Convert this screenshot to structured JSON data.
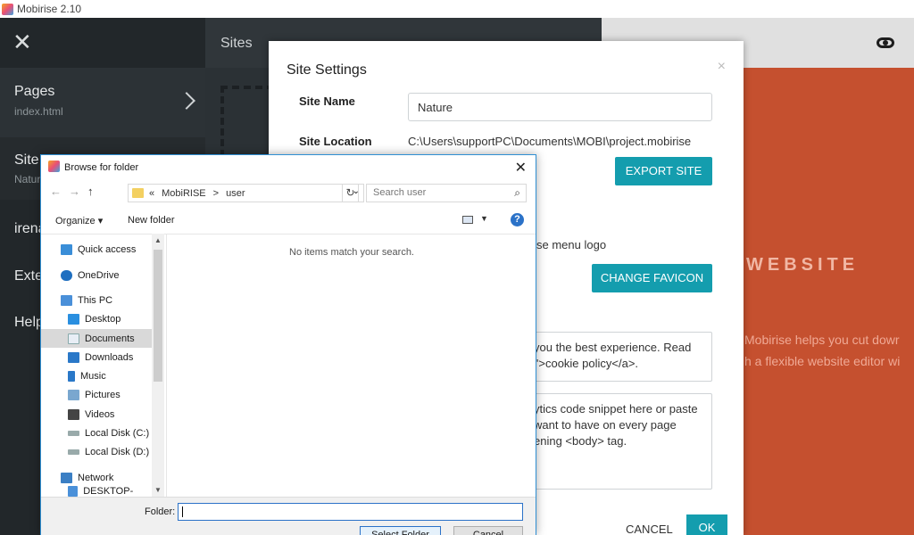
{
  "window": {
    "title": "Mobirise 2.10"
  },
  "sidebar": {
    "items": [
      {
        "label": "Pages",
        "sub": "index.html"
      },
      {
        "label": "Site",
        "sub": "Natur"
      },
      {
        "label": "irena"
      },
      {
        "label": "Exte"
      },
      {
        "label": "Help"
      }
    ]
  },
  "sites_panel": {
    "title": "Sites"
  },
  "preview": {
    "heading": "WEBSITE",
    "para_line1": "Mobirise helps you cut dowr",
    "para_line2": "h a flexible website editor wi"
  },
  "settings": {
    "title": "Site Settings",
    "close": "×",
    "site_name_label": "Site Name",
    "site_name_value": "Nature",
    "site_location_label": "Site Location",
    "site_location_value": "C:\\Users\\supportPC\\Documents\\MOBI\\project.mobirise",
    "export_label": "EXPORT SITE",
    "logo_text": "se menu logo",
    "favicon_label": "CHANGE FAVICON",
    "cookie_line1": "you the best experience. Read",
    "cookie_line2": "l'>cookie policy</a>.",
    "analytics_line1": "ytics code snippet here or paste",
    "analytics_line2": "want to have on every page",
    "analytics_line3": "ening <body> tag.",
    "cancel_label": "CANCEL",
    "ok_label": "OK"
  },
  "browse": {
    "title": "Browse for folder",
    "close": "✕",
    "breadcrumb": [
      "«",
      "MobiRISE",
      ">",
      "user"
    ],
    "search_placeholder": "Search user",
    "organize": "Organize ▾",
    "new_folder": "New folder",
    "empty_message": "No items match your search.",
    "nav_items": [
      {
        "label": "Quick access",
        "icon": "star-icon"
      },
      {
        "label": "OneDrive",
        "icon": "cloud-icon"
      },
      {
        "label": "This PC",
        "icon": "computer-icon"
      },
      {
        "label": "Desktop",
        "icon": "desktop-icon"
      },
      {
        "label": "Documents",
        "icon": "document-icon"
      },
      {
        "label": "Downloads",
        "icon": "download-icon"
      },
      {
        "label": "Music",
        "icon": "music-icon"
      },
      {
        "label": "Pictures",
        "icon": "pictures-icon"
      },
      {
        "label": "Videos",
        "icon": "videos-icon"
      },
      {
        "label": "Local Disk (C:)",
        "icon": "disk-icon"
      },
      {
        "label": "Local Disk (D:)",
        "icon": "disk-icon"
      },
      {
        "label": "Network",
        "icon": "network-icon"
      },
      {
        "label": "DESKTOP-POSTI",
        "icon": "computer-icon"
      }
    ],
    "folder_label": "Folder:",
    "folder_value": "",
    "select_label": "Select Folder",
    "cancel_label": "Cancel"
  },
  "colors": {
    "teal": "#149dae",
    "preview_bg": "#c5502f",
    "sidebar_bg": "#22272a"
  }
}
